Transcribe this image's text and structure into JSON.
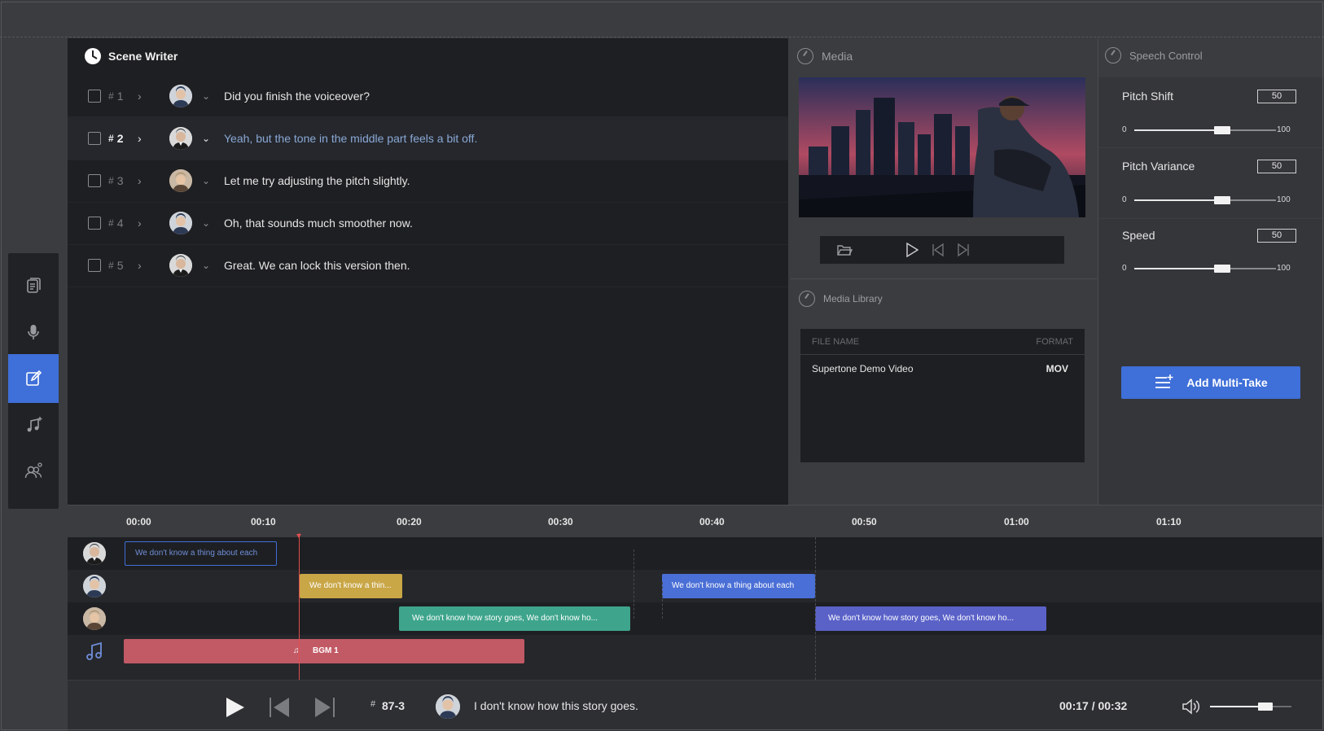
{
  "scene_writer": {
    "title": "Scene Writer",
    "lines": [
      {
        "num": "1",
        "text": "Did you finish the voiceover?"
      },
      {
        "num": "2",
        "text": "Yeah, but the tone in the middle part feels a bit off."
      },
      {
        "num": "3",
        "text": "Let me try adjusting the pitch slightly."
      },
      {
        "num": "4",
        "text": "Oh, that sounds much smoother now."
      },
      {
        "num": "5",
        "text": "Great. We can lock this version then."
      }
    ],
    "hash": "#"
  },
  "media": {
    "title": "Media"
  },
  "media_library": {
    "title": "Media Library",
    "columns": {
      "file_name": "FILE NAME",
      "format": "FORMAT"
    },
    "rows": [
      {
        "file_name": "Supertone Demo Video",
        "format": "MOV"
      }
    ]
  },
  "speech_control": {
    "title": "Speech Control",
    "params": [
      {
        "label": "Pitch Shift",
        "value": "50",
        "min": "0",
        "max": "100",
        "level": 0.62
      },
      {
        "label": "Pitch Variance",
        "value": "50",
        "min": "0",
        "max": "100",
        "level": 0.62
      },
      {
        "label": "Speed",
        "value": "50",
        "min": "0",
        "max": "100",
        "level": 0.62
      }
    ],
    "add_multitake_label": "Add Multi-Take"
  },
  "timeline": {
    "ticks": [
      "00:00",
      "00:10",
      "00:20",
      "00:30",
      "00:40",
      "00:50",
      "01:00",
      "01:10"
    ],
    "clips": {
      "c1": "We don't know a thing about each",
      "c2": "We don't know a thin...",
      "c3": "We don't know a thing about each",
      "c4": "We don't know how story goes, We don't know ho...",
      "c5": "We don't know how story goes, We don't know ho...",
      "bgm": "BGM 1"
    }
  },
  "transport": {
    "hash": "#",
    "take_id": "87-3",
    "line": "I don't know how this story goes.",
    "time": "00:17 / 00:32",
    "volume_level": 0.68
  },
  "colors": {
    "accent": "#3f6fd8",
    "clip_gold": "#c9a646",
    "clip_teal": "#3ea58c",
    "clip_blue": "#4a6fd6",
    "clip_indigo": "#5a62c8",
    "clip_bgm": "#c25a66",
    "playhead": "#e04f4f"
  }
}
